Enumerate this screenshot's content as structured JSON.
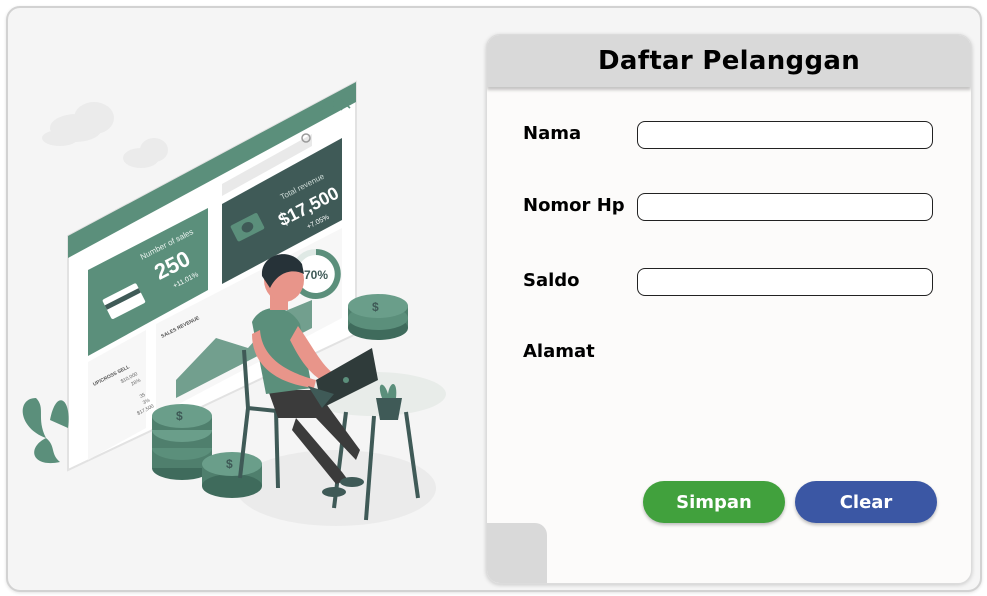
{
  "form": {
    "title": "Daftar Pelanggan",
    "fields": [
      {
        "label": "Nama",
        "value": "",
        "placeholder": ""
      },
      {
        "label": "Nomor Hp",
        "value": "",
        "placeholder": ""
      },
      {
        "label": "Saldo",
        "value": "",
        "placeholder": ""
      },
      {
        "label": "Alamat"
      }
    ],
    "buttons": {
      "save_label": "Simpan",
      "clear_label": "Clear"
    },
    "colors": {
      "save": "#41a13d",
      "clear": "#3b57a4",
      "header": "#d9d9d9"
    }
  },
  "illustration": {
    "number_of_sales_label": "Number of sales",
    "number_of_sales_value": "250",
    "number_of_sales_change": "+11.01%",
    "total_revenue_label": "Total revenue",
    "total_revenue_value": "$17,500",
    "total_revenue_change": "+7.05%",
    "progress_text": "70%",
    "progress_fraction": 0.7,
    "sales_revenue_label": "SALES REVENUE",
    "upsell_label": "UP/CROSS SELL",
    "upsell_value_1": "$10,000",
    "upsell_pct_1": "28%",
    "upsell_value_2": "35",
    "upsell_pct_2": "3%",
    "upsell_value_3": "$17,500",
    "icons": [
      "cloud-icon",
      "search-icon",
      "menu-icon",
      "close-icon",
      "credit-card-icon",
      "banknote-icon",
      "dollar-coin-icon",
      "plant-icon",
      "laptop-icon"
    ],
    "accent": "#5b8f7b",
    "dark_panel": "#3f5a57"
  }
}
